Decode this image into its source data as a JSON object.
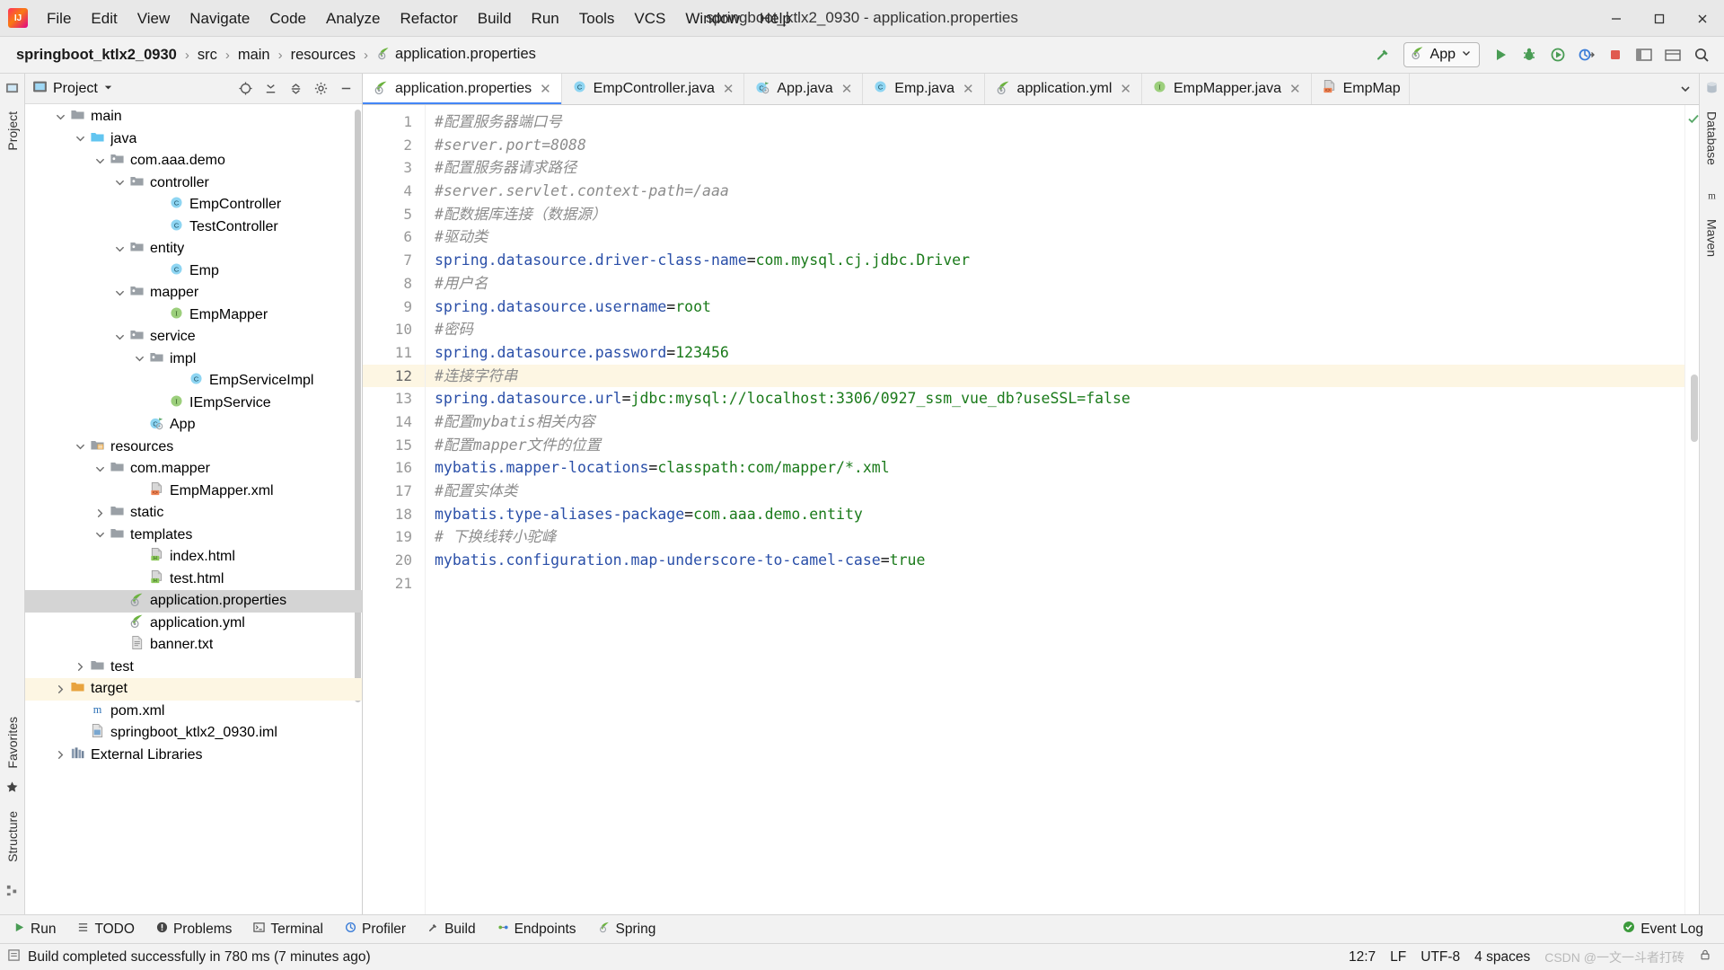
{
  "window": {
    "title": "springboot_ktlx2_0930 - application.properties",
    "minimize": "─",
    "maximize": "☐",
    "close": "✕"
  },
  "menu": [
    {
      "label": "File"
    },
    {
      "label": "Edit"
    },
    {
      "label": "View"
    },
    {
      "label": "Navigate"
    },
    {
      "label": "Code"
    },
    {
      "label": "Analyze"
    },
    {
      "label": "Refactor"
    },
    {
      "label": "Build"
    },
    {
      "label": "Run"
    },
    {
      "label": "Tools"
    },
    {
      "label": "VCS"
    },
    {
      "label": "Window"
    },
    {
      "label": "Help"
    }
  ],
  "breadcrumb": {
    "separator": "›",
    "items": [
      {
        "label": "springboot_ktlx2_0930",
        "bold": true,
        "icon": "none"
      },
      {
        "label": "src",
        "bold": false,
        "icon": "none"
      },
      {
        "label": "main",
        "bold": false,
        "icon": "none"
      },
      {
        "label": "resources",
        "bold": false,
        "icon": "none"
      },
      {
        "label": "application.properties",
        "bold": false,
        "icon": "spring-leaf-icon"
      }
    ]
  },
  "toolbar": {
    "run_config_label": "App",
    "buttons": [
      {
        "name": "build-hammer-icon"
      },
      {
        "name": "run-icon"
      },
      {
        "name": "debug-icon"
      },
      {
        "name": "run-coverage-icon"
      },
      {
        "name": "profiler-icon"
      },
      {
        "name": "stop-icon"
      },
      {
        "name": "updates-icon"
      },
      {
        "name": "layout-icon"
      },
      {
        "name": "search-icon"
      }
    ]
  },
  "project_panel": {
    "title": "Project",
    "dropdown_caret": "▾",
    "actions": [
      {
        "name": "select-opened-file-icon"
      },
      {
        "name": "expand-all-icon"
      },
      {
        "name": "collapse-all-icon"
      },
      {
        "name": "settings-gear-icon"
      },
      {
        "name": "hide-panel-icon"
      }
    ],
    "tree": [
      {
        "label": "main",
        "indent": 2,
        "twist": "open",
        "icon": "folder-gray",
        "state": "normal"
      },
      {
        "label": "java",
        "indent": 3,
        "twist": "open",
        "icon": "folder-blue",
        "state": "normal"
      },
      {
        "label": "com.aaa.demo",
        "indent": 4,
        "twist": "open",
        "icon": "package-icon",
        "state": "normal"
      },
      {
        "label": "controller",
        "indent": 5,
        "twist": "open",
        "icon": "package-icon",
        "state": "normal"
      },
      {
        "label": "EmpController",
        "indent": 7,
        "twist": "none",
        "icon": "java-class-icon",
        "state": "normal"
      },
      {
        "label": "TestController",
        "indent": 7,
        "twist": "none",
        "icon": "java-class-icon",
        "state": "normal"
      },
      {
        "label": "entity",
        "indent": 5,
        "twist": "open",
        "icon": "package-icon",
        "state": "normal"
      },
      {
        "label": "Emp",
        "indent": 7,
        "twist": "none",
        "icon": "java-class-icon",
        "state": "normal"
      },
      {
        "label": "mapper",
        "indent": 5,
        "twist": "open",
        "icon": "package-icon",
        "state": "normal"
      },
      {
        "label": "EmpMapper",
        "indent": 7,
        "twist": "none",
        "icon": "java-interface-icon",
        "state": "normal"
      },
      {
        "label": "service",
        "indent": 5,
        "twist": "open",
        "icon": "package-icon",
        "state": "normal"
      },
      {
        "label": "impl",
        "indent": 6,
        "twist": "open",
        "icon": "package-icon",
        "state": "normal"
      },
      {
        "label": "EmpServiceImpl",
        "indent": 8,
        "twist": "none",
        "icon": "java-class-icon",
        "state": "normal"
      },
      {
        "label": "IEmpService",
        "indent": 7,
        "twist": "none",
        "icon": "java-interface-icon",
        "state": "normal"
      },
      {
        "label": "App",
        "indent": 6,
        "twist": "none",
        "icon": "spring-boot-app-icon",
        "state": "normal"
      },
      {
        "label": "resources",
        "indent": 3,
        "twist": "open",
        "icon": "resources-folder-icon",
        "state": "normal"
      },
      {
        "label": "com.mapper",
        "indent": 4,
        "twist": "open",
        "icon": "folder-gray",
        "state": "normal"
      },
      {
        "label": "EmpMapper.xml",
        "indent": 6,
        "twist": "none",
        "icon": "xml-file-icon",
        "state": "normal"
      },
      {
        "label": "static",
        "indent": 4,
        "twist": "closed",
        "icon": "folder-gray",
        "state": "normal"
      },
      {
        "label": "templates",
        "indent": 4,
        "twist": "open",
        "icon": "folder-gray",
        "state": "normal"
      },
      {
        "label": "index.html",
        "indent": 6,
        "twist": "none",
        "icon": "html-file-icon",
        "state": "normal"
      },
      {
        "label": "test.html",
        "indent": 6,
        "twist": "none",
        "icon": "html-file-icon",
        "state": "normal"
      },
      {
        "label": "application.properties",
        "indent": 5,
        "twist": "none",
        "icon": "spring-leaf-icon",
        "state": "selected"
      },
      {
        "label": "application.yml",
        "indent": 5,
        "twist": "none",
        "icon": "spring-leaf-icon",
        "state": "normal"
      },
      {
        "label": "banner.txt",
        "indent": 5,
        "twist": "none",
        "icon": "text-file-icon",
        "state": "normal"
      },
      {
        "label": "test",
        "indent": 3,
        "twist": "closed",
        "icon": "folder-gray",
        "state": "normal"
      },
      {
        "label": "target",
        "indent": 2,
        "twist": "closed",
        "icon": "folder-orange",
        "state": "target"
      },
      {
        "label": "pom.xml",
        "indent": 3,
        "twist": "none",
        "icon": "maven-icon",
        "state": "normal"
      },
      {
        "label": "springboot_ktlx2_0930.iml",
        "indent": 3,
        "twist": "none",
        "icon": "iml-file-icon",
        "state": "normal"
      },
      {
        "label": "External Libraries",
        "indent": 2,
        "twist": "closed",
        "icon": "libraries-icon",
        "state": "normal"
      }
    ]
  },
  "editor_tabs": [
    {
      "label": "application.properties",
      "icon": "spring-leaf-icon",
      "active": true,
      "close": "✕"
    },
    {
      "label": "EmpController.java",
      "icon": "java-class-icon",
      "active": false,
      "close": "✕"
    },
    {
      "label": "App.java",
      "icon": "spring-boot-app-icon",
      "active": false,
      "close": "✕"
    },
    {
      "label": "Emp.java",
      "icon": "java-class-icon",
      "active": false,
      "close": "✕"
    },
    {
      "label": "application.yml",
      "icon": "spring-leaf-icon",
      "active": false,
      "close": "✕"
    },
    {
      "label": "EmpMapper.java",
      "icon": "java-interface-icon",
      "active": false,
      "close": "✕"
    },
    {
      "label": "EmpMap",
      "icon": "xml-file-icon",
      "active": false,
      "close": ""
    }
  ],
  "editor": {
    "current_line": 12,
    "lines": [
      {
        "n": 1,
        "tokens": [
          {
            "t": "#配置服务器端口号",
            "c": "cmt"
          }
        ]
      },
      {
        "n": 2,
        "tokens": [
          {
            "t": "#server.port=8088",
            "c": "cmt"
          }
        ]
      },
      {
        "n": 3,
        "tokens": [
          {
            "t": "#配置服务器请求路径",
            "c": "cmt"
          }
        ]
      },
      {
        "n": 4,
        "tokens": [
          {
            "t": "#server.servlet.context-path=/aaa",
            "c": "cmt"
          }
        ]
      },
      {
        "n": 5,
        "tokens": [
          {
            "t": "#配数据库连接（数据源）",
            "c": "cmt"
          }
        ]
      },
      {
        "n": 6,
        "tokens": [
          {
            "t": "#驱动类",
            "c": "cmt"
          }
        ]
      },
      {
        "n": 7,
        "tokens": [
          {
            "t": "spring.datasource.driver-class-name",
            "c": "key"
          },
          {
            "t": "=",
            "c": "eq"
          },
          {
            "t": "com.mysql.cj.jdbc.Driver",
            "c": "val"
          }
        ]
      },
      {
        "n": 8,
        "tokens": [
          {
            "t": "#用户名",
            "c": "cmt"
          }
        ]
      },
      {
        "n": 9,
        "tokens": [
          {
            "t": "spring.datasource.username",
            "c": "key"
          },
          {
            "t": "=",
            "c": "eq"
          },
          {
            "t": "root",
            "c": "val"
          }
        ]
      },
      {
        "n": 10,
        "tokens": [
          {
            "t": "#密码",
            "c": "cmt"
          }
        ]
      },
      {
        "n": 11,
        "tokens": [
          {
            "t": "spring.datasource.password",
            "c": "key"
          },
          {
            "t": "=",
            "c": "eq"
          },
          {
            "t": "123456",
            "c": "num"
          }
        ]
      },
      {
        "n": 12,
        "tokens": [
          {
            "t": "#连接字符串",
            "c": "cmt"
          }
        ]
      },
      {
        "n": 13,
        "tokens": [
          {
            "t": "spring.datasource.url",
            "c": "key"
          },
          {
            "t": "=",
            "c": "eq"
          },
          {
            "t": "jdbc:mysql://localhost:3306/0927_ssm_vue_db?useSSL=false",
            "c": "val"
          }
        ]
      },
      {
        "n": 14,
        "tokens": [
          {
            "t": "#配置mybatis相关内容",
            "c": "cmt"
          }
        ]
      },
      {
        "n": 15,
        "tokens": [
          {
            "t": "#配置mapper文件的位置",
            "c": "cmt"
          }
        ]
      },
      {
        "n": 16,
        "tokens": [
          {
            "t": "mybatis.mapper-locations",
            "c": "key"
          },
          {
            "t": "=",
            "c": "eq"
          },
          {
            "t": "classpath:com/mapper/*.xml",
            "c": "val"
          }
        ]
      },
      {
        "n": 17,
        "tokens": [
          {
            "t": "#配置实体类",
            "c": "cmt"
          }
        ]
      },
      {
        "n": 18,
        "tokens": [
          {
            "t": "mybatis.type-aliases-package",
            "c": "key"
          },
          {
            "t": "=",
            "c": "eq"
          },
          {
            "t": "com.aaa.demo.entity",
            "c": "val"
          }
        ]
      },
      {
        "n": 19,
        "tokens": [
          {
            "t": "# 下换线转小驼峰",
            "c": "cmt"
          }
        ]
      },
      {
        "n": 20,
        "tokens": [
          {
            "t": "mybatis.configuration.map-underscore-to-camel-case",
            "c": "key"
          },
          {
            "t": "=",
            "c": "eq"
          },
          {
            "t": "true",
            "c": "val"
          }
        ]
      },
      {
        "n": 21,
        "tokens": []
      }
    ]
  },
  "left_rail": {
    "top": [
      {
        "label": "Project",
        "icon": "project-icon"
      }
    ],
    "bottom": [
      {
        "label": "Structure",
        "icon": "structure-icon"
      },
      {
        "label": "Favorites",
        "icon": "favorites-star-icon"
      }
    ]
  },
  "right_rail": {
    "items": [
      {
        "label": "Database",
        "icon": "database-icon"
      },
      {
        "label": "Maven",
        "icon": "maven-m-icon"
      }
    ]
  },
  "bottom_toolwindows": [
    {
      "label": "Run",
      "icon": "run-green-icon"
    },
    {
      "label": "TODO",
      "icon": "todo-list-icon"
    },
    {
      "label": "Problems",
      "icon": "problems-icon"
    },
    {
      "label": "Terminal",
      "icon": "terminal-icon"
    },
    {
      "label": "Profiler",
      "icon": "profiler-icon"
    },
    {
      "label": "Build",
      "icon": "build-hammer-icon"
    },
    {
      "label": "Endpoints",
      "icon": "endpoints-icon"
    },
    {
      "label": "Spring",
      "icon": "spring-leaf-icon"
    }
  ],
  "event_log": {
    "label": "Event Log",
    "icon": "event-log-icon"
  },
  "status_bar": {
    "message": "Build completed successfully in 780 ms (7 minutes ago)",
    "caret_position": "12:7",
    "line_separator": "LF",
    "encoding": "UTF-8",
    "indent": "4 spaces",
    "watermark": "CSDN @一文一斗者打砖"
  }
}
